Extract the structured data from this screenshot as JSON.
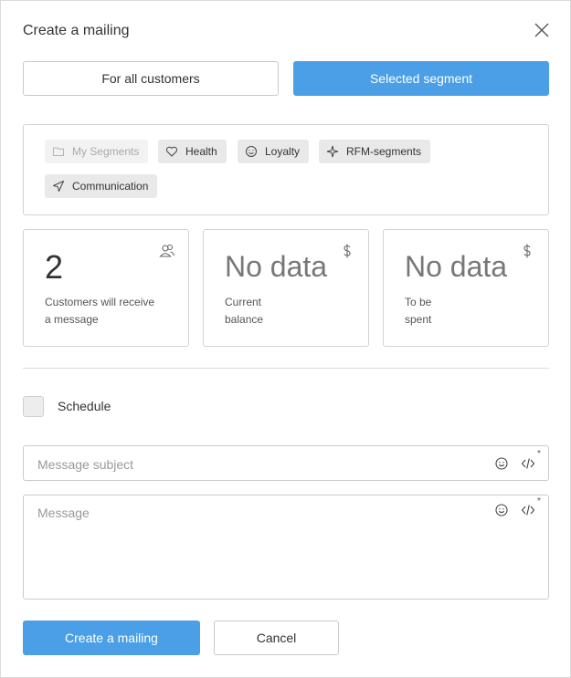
{
  "dialog": {
    "title": "Create a mailing"
  },
  "audience": {
    "all_label": "For all customers",
    "selected_label": "Selected segment"
  },
  "segments": {
    "my_segments": "My Segments",
    "health": "Health",
    "loyalty": "Loyalty",
    "rfm": "RFM-segments",
    "communication": "Communication"
  },
  "stats": {
    "customers": {
      "value": "2",
      "line1": "Customers will receive",
      "line2": "a message"
    },
    "balance": {
      "value": "No data",
      "line1": "Current",
      "line2": "balance"
    },
    "spent": {
      "value": "No data",
      "line1": "To be",
      "line2": "spent"
    }
  },
  "schedule": {
    "label": "Schedule",
    "checked": false
  },
  "subject": {
    "placeholder": "Message subject",
    "value": "",
    "required_mark": "*"
  },
  "message": {
    "placeholder": "Message",
    "value": "",
    "required_mark": "*"
  },
  "actions": {
    "create_label": "Create a mailing",
    "cancel_label": "Cancel"
  },
  "icons": {
    "close": "close-icon",
    "folder": "folder-icon",
    "heart": "heart-icon",
    "smile": "smile-icon",
    "rfm": "rfm-icon",
    "send": "send-icon",
    "users": "users-icon",
    "dollar": "dollar-icon",
    "emoji": "emoji-icon",
    "code": "code-icon"
  },
  "colors": {
    "accent": "#4a9fe6",
    "chip_bg": "#e9e9e9",
    "border": "#d3d3d3"
  }
}
